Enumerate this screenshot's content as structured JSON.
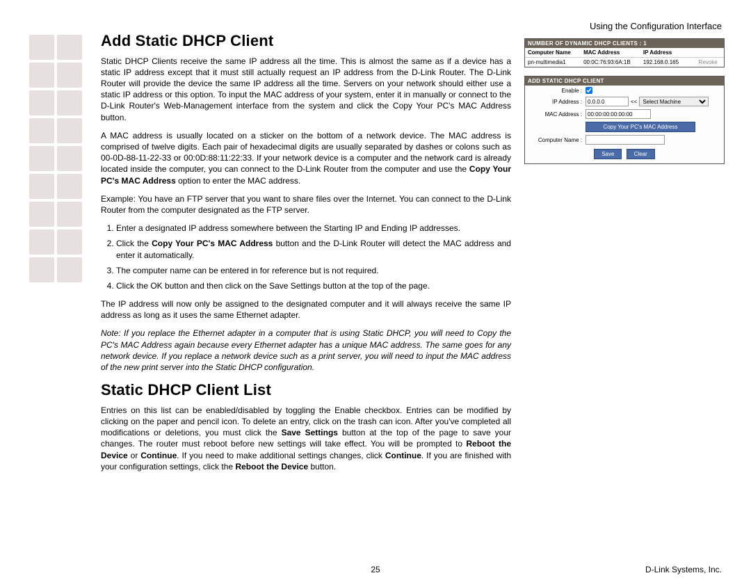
{
  "header_right": "Using the Configuration Interface",
  "section1": {
    "title": "Add Static DHCP Client",
    "p1a": "Static DHCP Clients receive the same IP address all the time. This is almost the same as if a device has a static IP address except that it must still actually request an IP address from the D-Link Router. The D-Link Router will provide the device the same IP address all the time. Servers on your network should either use a static IP address or this option. To input the MAC address of your system, enter it in manually or connect to the D-Link Router's Web-Management interface from the system and click the Copy Your PC's MAC Address button.",
    "p2a": "A MAC address is usually located on a sticker on the bottom of a network device. The MAC address is comprised of twelve digits. Each pair of hexadecimal digits are usually separated by dashes or colons such as 00-0D-88-11-22-33 or 00:0D:88:11:22:33. If your network device is a computer and the network card is already located inside the computer, you can connect to the D-Link Router from the computer and use the ",
    "p2b": "Copy Your PC's MAC Address",
    "p2c": " option to enter the MAC address.",
    "p3": "Example: You have an FTP server that you want to share files over the Internet. You can connect to the D-Link Router from the computer designated as the FTP server.",
    "li1": "Enter a designated IP address somewhere between the Starting IP and Ending IP addresses.",
    "li2a": "Click the ",
    "li2b": "Copy Your PC's MAC Address",
    "li2c": " button and the D-Link Router will detect the MAC address and enter it automatically.",
    "li3": "The computer name can be entered in for reference but is not required.",
    "li4": "Click the OK button and then click on the Save Settings button at the top of the page.",
    "p4": "The IP address will now only be assigned to the designated computer and it will always receive the same IP address as long as it uses the same Ethernet adapter.",
    "note": "Note: If you replace the Ethernet adapter in a computer that is using Static DHCP, you will need to Copy the PC's MAC Address again because every Ethernet adapter has a unique MAC address. The same goes for any network device. If you replace a network device such as a print server, you will need to input the MAC address of the new print server into the Static DHCP configuration."
  },
  "section2": {
    "title": "Static DHCP Client List",
    "p1a": "Entries on this list can be enabled/disabled by toggling the Enable checkbox. Entries can be modified by clicking on the paper and pencil icon. To delete an entry, click on the trash can icon. After you've completed all modifications or deletions, you must click the ",
    "p1b": "Save Settings",
    "p1c": " button at the top of the page to save your changes. The router must reboot before new settings will take effect. You will be prompted to ",
    "p1d": "Reboot the Device",
    "p1e": " or ",
    "p1f": "Continue",
    "p1g": ". If you need to make additional settings changes, click ",
    "p1h": "Continue",
    "p1i": ". If you are finished with your configuration settings, click the ",
    "p1j": "Reboot the Device",
    "p1k": " button."
  },
  "dynamic_panel": {
    "title": "NUMBER OF DYNAMIC DHCP CLIENTS : 1",
    "cols": {
      "c1": "Computer Name",
      "c2": "MAC Address",
      "c3": "IP Address"
    },
    "row": {
      "name": "pn-multimedia1",
      "mac": "00:0C:76:93:6A:1B",
      "ip": "192.168.0.165",
      "action": "Revoke"
    }
  },
  "add_panel": {
    "title": "ADD STATIC DHCP CLIENT",
    "enable_label": "Enable :",
    "ip_label": "IP Address :",
    "ip_value": "0.0.0.0",
    "select_label": "Select Machine",
    "mac_label": "MAC Address :",
    "mac_value": "00:00:00:00:00:00",
    "copy_btn": "Copy Your PC's MAC Address",
    "cname_label": "Computer Name :",
    "save_btn": "Save",
    "clear_btn": "Clear",
    "angle": "<<"
  },
  "footer": {
    "page": "25",
    "company": "D-Link Systems, Inc."
  }
}
